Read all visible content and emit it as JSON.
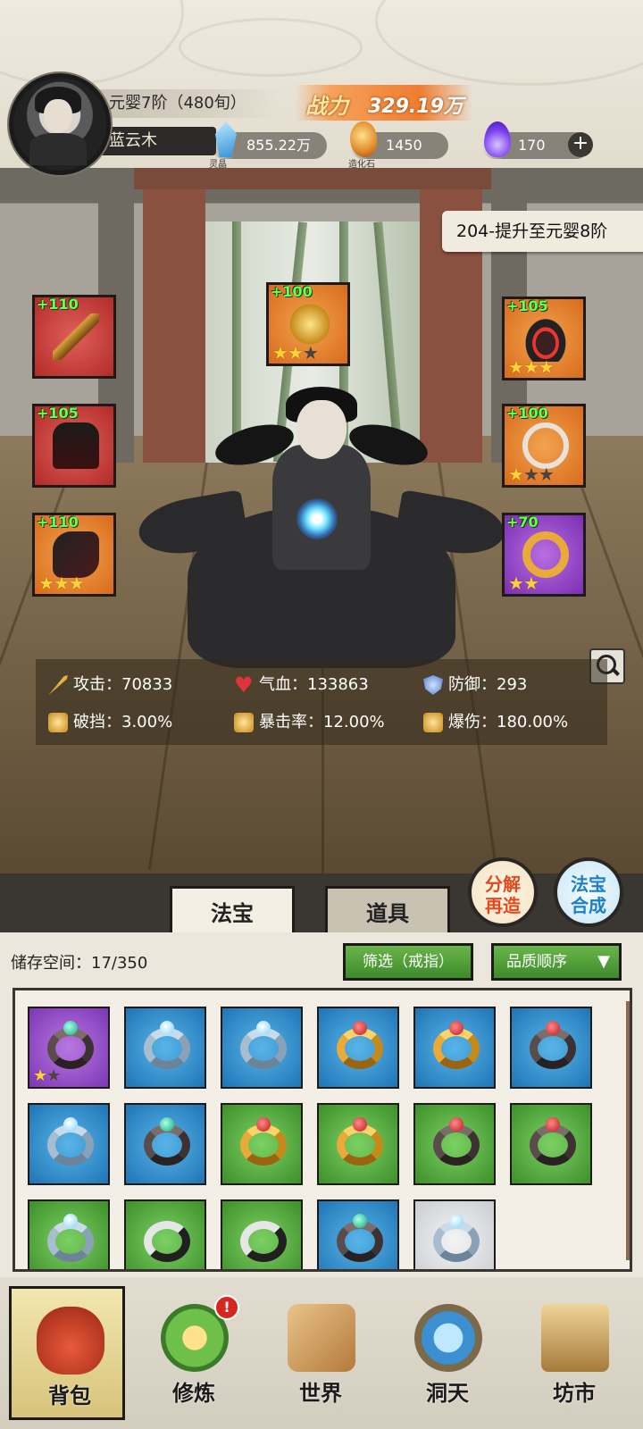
{
  "player": {
    "realm": "元婴7阶（480旬）",
    "name": "蓝云木",
    "power_label": "战力",
    "power_value": "329.19万"
  },
  "resources": [
    {
      "name": "灵晶",
      "value": "855.22万",
      "icon": "blue-crystal-icon"
    },
    {
      "name": "造化石",
      "value": "1450",
      "icon": "creation-stone-icon"
    },
    {
      "name": "",
      "value": "170",
      "icon": "purple-flame-icon"
    }
  ],
  "level_tag": "204-提升至元婴8阶",
  "equipped": [
    {
      "slot": "weapon",
      "plus": "+110",
      "color": "red",
      "stars": 0
    },
    {
      "slot": "top-center",
      "plus": "+100",
      "color": "orange",
      "stars": 2,
      "max_stars": 3
    },
    {
      "slot": "crown",
      "plus": "+105",
      "color": "orange",
      "stars": 3,
      "max_stars": 3
    },
    {
      "slot": "armor",
      "plus": "+105",
      "color": "red",
      "stars": 0
    },
    {
      "slot": "necklace",
      "plus": "+100",
      "color": "orange",
      "stars": 1,
      "max_stars": 3
    },
    {
      "slot": "boots",
      "plus": "+110",
      "color": "orange",
      "stars": 3,
      "max_stars": 3
    },
    {
      "slot": "ring",
      "plus": "+70",
      "color": "purple",
      "stars": 2,
      "max_stars": 2
    }
  ],
  "stats": {
    "attack": "攻击：70833",
    "hp": "气血：133863",
    "defense": "防御：293",
    "pierce": "破挡：3.00%",
    "crit_rate": "暴击率：12.00%",
    "crit_dmg": "爆伤：180.00%"
  },
  "actions": {
    "decompose": "分解再造",
    "compose": "法宝合成"
  },
  "tabs": {
    "fabao": "法宝",
    "daoju": "道具"
  },
  "storage": {
    "label": "储存空间：17/350",
    "filter": "筛选（戒指）",
    "sort": "品质顺序"
  },
  "inventory": [
    {
      "color": "purple",
      "ring": "dark",
      "gem": "teal",
      "stars": 1,
      "max_stars": 2
    },
    {
      "color": "blue",
      "ring": "silver",
      "gem": "ice"
    },
    {
      "color": "blue",
      "ring": "silver",
      "gem": "ice"
    },
    {
      "color": "blue",
      "ring": "gold",
      "gem": "red"
    },
    {
      "color": "blue",
      "ring": "gold",
      "gem": "red"
    },
    {
      "color": "blue",
      "ring": "dark",
      "gem": "red"
    },
    {
      "color": "blue",
      "ring": "silver",
      "gem": "ice"
    },
    {
      "color": "blue",
      "ring": "dark",
      "gem": "teal"
    },
    {
      "color": "green",
      "ring": "gold",
      "gem": "red"
    },
    {
      "color": "green",
      "ring": "gold",
      "gem": "red"
    },
    {
      "color": "green",
      "ring": "dark",
      "gem": "red"
    },
    {
      "color": "green",
      "ring": "dark",
      "gem": "red"
    },
    {
      "color": "green",
      "ring": "silver",
      "gem": "ice"
    },
    {
      "color": "green",
      "ring": "yin",
      "gem": ""
    },
    {
      "color": "green",
      "ring": "yin",
      "gem": ""
    },
    {
      "color": "blue",
      "ring": "dark",
      "gem": "teal"
    },
    {
      "color": "white",
      "ring": "silver",
      "gem": "ice"
    }
  ],
  "nav": [
    {
      "label": "背包",
      "icon": "bag-icon"
    },
    {
      "label": "修炼",
      "icon": "lotus-icon",
      "alert": "!"
    },
    {
      "label": "世界",
      "icon": "scroll-map-icon"
    },
    {
      "label": "洞天",
      "icon": "portal-icon"
    },
    {
      "label": "坊市",
      "icon": "market-cart-icon"
    }
  ]
}
